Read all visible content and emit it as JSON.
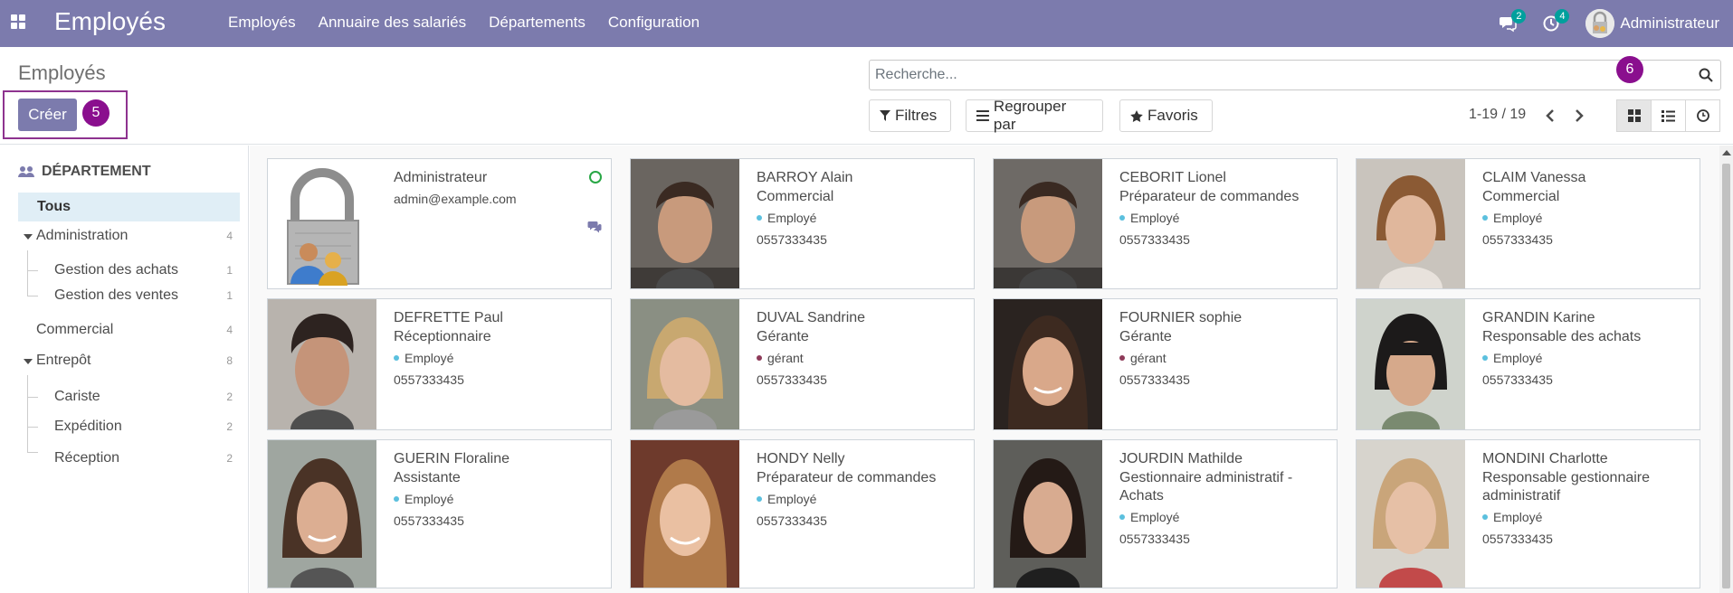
{
  "navbar": {
    "app_title": "Employés",
    "menu": [
      "Employés",
      "Annuaire des salariés",
      "Départements",
      "Configuration"
    ],
    "messages_count": "2",
    "activities_count": "4",
    "user_name": "Administrateur",
    "bg_color": "#7c7bad"
  },
  "control_panel": {
    "breadcrumb": "Employés",
    "create_label": "Créer",
    "step_badge_create": "5",
    "step_badge_search": "6",
    "search_placeholder": "Recherche...",
    "filters_label": "Filtres",
    "group_by_label": "Regrouper par",
    "favorites_label": "Favoris",
    "pager": "1-19 / 19"
  },
  "sidebar": {
    "header": "DÉPARTEMENT",
    "items": [
      {
        "label": "Tous",
        "count": ""
      },
      {
        "label": "Administration",
        "count": "4"
      },
      {
        "label": "Gestion des achats",
        "count": "1"
      },
      {
        "label": "Gestion des ventes",
        "count": "1"
      },
      {
        "label": "Commercial",
        "count": "4"
      },
      {
        "label": "Entrepôt",
        "count": "8"
      },
      {
        "label": "Cariste",
        "count": "2"
      },
      {
        "label": "Expédition",
        "count": "2"
      },
      {
        "label": "Réception",
        "count": "2"
      }
    ]
  },
  "employees": [
    {
      "name": "Administrateur",
      "email": "admin@example.com",
      "job": "",
      "tag": "",
      "phone": ""
    },
    {
      "name": "BARROY Alain",
      "job": "Commercial",
      "tag": "Employé",
      "phone": "0557333435"
    },
    {
      "name": "CEBORIT Lionel",
      "job": "Préparateur de commandes",
      "tag": "Employé",
      "phone": "0557333435"
    },
    {
      "name": "CLAIM Vanessa",
      "job": "Commercial",
      "tag": "Employé",
      "phone": "0557333435"
    },
    {
      "name": "DEFRETTE Paul",
      "job": "Réceptionnaire",
      "tag": "Employé",
      "phone": "0557333435"
    },
    {
      "name": "DUVAL Sandrine",
      "job": "Gérante",
      "tag": "gérant",
      "phone": "0557333435"
    },
    {
      "name": "FOURNIER sophie",
      "job": "Gérante",
      "tag": "gérant",
      "phone": "0557333435"
    },
    {
      "name": "GRANDIN Karine",
      "job": "Responsable des achats",
      "tag": "Employé",
      "phone": "0557333435"
    },
    {
      "name": "GUERIN Floraline",
      "job": "Assistante",
      "tag": "Employé",
      "phone": "0557333435"
    },
    {
      "name": "HONDY Nelly",
      "job": "Préparateur de commandes",
      "tag": "Employé",
      "phone": "0557333435"
    },
    {
      "name": "JOURDIN Mathilde",
      "job": "Gestionnaire administratif - Achats",
      "tag": "Employé",
      "phone": "0557333435"
    },
    {
      "name": "MONDINI Charlotte",
      "job": "Responsable gestionnaire administratif",
      "tag": "Employé",
      "phone": "0557333435"
    }
  ],
  "colors": {
    "tag_employe": "#5bc0de",
    "tag_gerant": "#8e3a59",
    "step_badge": "#8a0f8e"
  }
}
